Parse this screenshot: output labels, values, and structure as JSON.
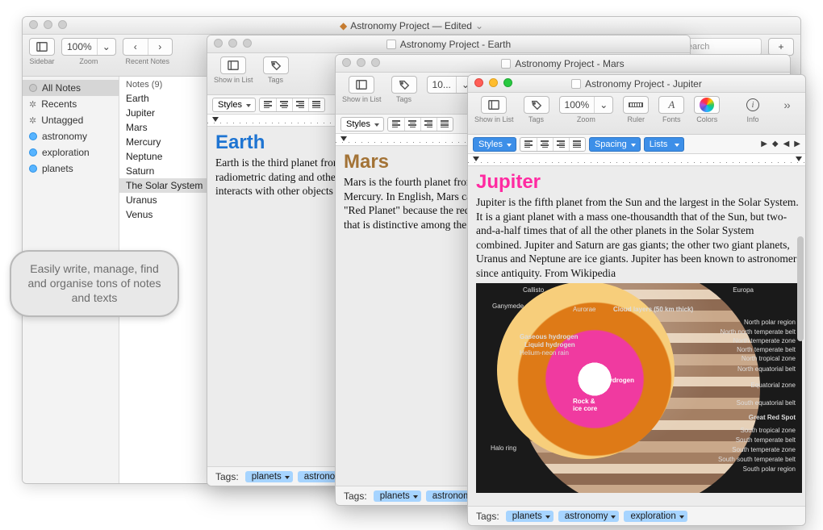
{
  "main": {
    "title": "Astronomy Project — Edited",
    "toolbar": {
      "sidebar": "Sidebar",
      "zoom_value": "100%",
      "zoom": "Zoom",
      "recent": "Recent Notes"
    },
    "search_placeholder": "Easy Search",
    "source_items": [
      {
        "label": "All Notes",
        "icon": "gray",
        "sel": true
      },
      {
        "label": "Recents",
        "icon": "gear"
      },
      {
        "label": "Untagged",
        "icon": "tag"
      },
      {
        "label": "astronomy",
        "icon": "blue"
      },
      {
        "label": "exploration",
        "icon": "blue"
      },
      {
        "label": "planets",
        "icon": "blue"
      }
    ],
    "notes_header": "Notes (9)",
    "notes_items": [
      {
        "label": "Earth"
      },
      {
        "label": "Jupiter"
      },
      {
        "label": "Mars"
      },
      {
        "label": "Mercury"
      },
      {
        "label": "Neptune"
      },
      {
        "label": "Saturn"
      },
      {
        "label": "The Solar System",
        "sel": true
      },
      {
        "label": "Uranus"
      },
      {
        "label": "Venus"
      }
    ],
    "tags_label": "Tags:",
    "tags": [
      "planets",
      "astronomy"
    ]
  },
  "earth": {
    "title": "Astronomy Project - Earth",
    "show_in_list": "Show in List",
    "tags_label": "Tags",
    "styles": "Styles",
    "note_title": "Earth",
    "body": "Earth is the third planet from the Sun and the only astronomical object known to harbor life. According to radiometric dating and other sources of evidence, Earth formed over 4.5 billion years ago. Earth's gravity interacts with other objects in space, especially the Sun and the Moon, Earth's only natural satellite.",
    "tagbar_label": "Tags:",
    "tags": [
      "planets",
      "astronomy"
    ]
  },
  "mars": {
    "title": "Astronomy Project - Mars",
    "show_in_list": "Show in List",
    "tags_label": "Tags",
    "zoom": "10...",
    "styles": "Styles",
    "note_title": "Mars",
    "body": "Mars is the fourth planet from the Sun and the second-smallest planet in the Solar System after Mercury. In English, Mars carries a name of the Roman god of war, and is often referred to as the \"Red Planet\" because the reddish iron oxide prevalent on its surface gives it a reddish appearance that is distinctive among the astronomical bodies visible to the naked eye. From Wikipedia",
    "tagbar_label": "Tags:",
    "tags": [
      "planets",
      "astronomy"
    ]
  },
  "jupiter": {
    "title": "Astronomy Project - Jupiter",
    "show_in_list": "Show in List",
    "tags_label": "Tags",
    "zoom_value": "100%",
    "zoom": "Zoom",
    "ruler": "Ruler",
    "fonts": "Fonts",
    "colors": "Colors",
    "info": "Info",
    "styles": "Styles",
    "spacing": "Spacing",
    "lists": "Lists",
    "note_title": "Jupiter",
    "body": "Jupiter is the fifth planet from the Sun and the largest in the Solar System. It is a giant planet with a mass one-thousandth that of the Sun, but two-and-a-half times that of all the other planets in the Solar System combined. Jupiter and Saturn are gas giants; the other two giant planets, Uranus and Neptune are ice giants. Jupiter has been known to astronomers since antiquity. From Wikipedia",
    "diagram_labels": {
      "callisto": "Callisto",
      "ganymede": "Ganymede",
      "europa": "Europa",
      "aurorae": "Aurorae",
      "cloud": "Cloud layers (50 km thick)",
      "gaseous": "Gaseous hydrogen",
      "liquid": "Liquid hydrogen",
      "helium": "Helium-neon rain",
      "metallic": "Metallic hydrogen",
      "core": "Rock & ice core",
      "halo": "Halo ring",
      "npolar": "North polar region",
      "nntemp": "North north temperate belt",
      "ntempz": "North temperate zone",
      "ntemp": "North temperate belt",
      "ntrop": "North tropical zone",
      "neq": "North equatorial belt",
      "eq": "Equatorial zone",
      "seq": "South equatorial belt",
      "redspot": "Great Red Spot",
      "strop": "South tropical zone",
      "stemp": "South temperate belt",
      "stempz": "South temperate zone",
      "sstemp": "South south temperate belt",
      "spolar": "South polar region"
    },
    "tagbar_label": "Tags:",
    "tags": [
      "planets",
      "astronomy",
      "exploration"
    ]
  },
  "callout": "Easily write, manage, find and organise tons of notes and texts"
}
